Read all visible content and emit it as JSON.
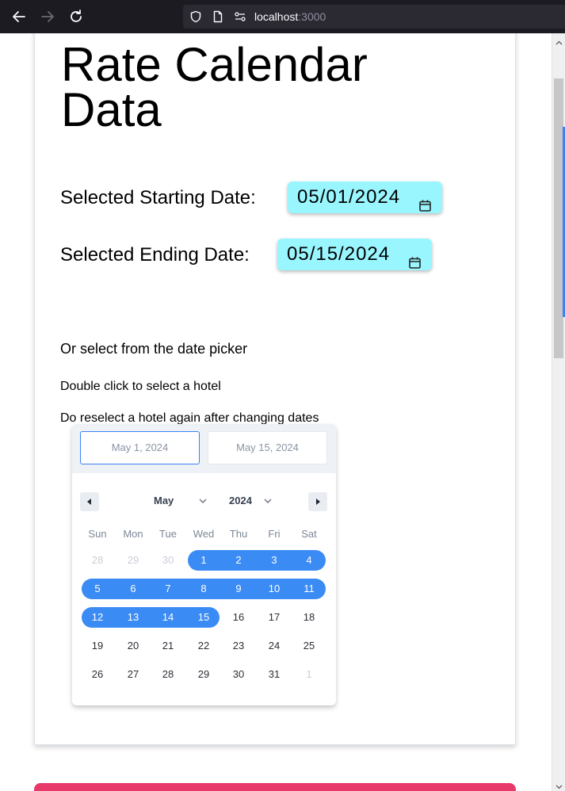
{
  "browser": {
    "url_host": "localhost",
    "url_port": ":3000"
  },
  "page": {
    "title": "Rate Calendar Data",
    "start_label": "Selected Starting Date:",
    "start_value": "05/01/2024",
    "end_label": "Selected Ending Date:",
    "end_value": "05/15/2024",
    "hint_picker": "Or select from the date picker",
    "hint_hotel": "Double click to select a hotel",
    "hint_reselect": "Do reselect a hotel again after changing dates"
  },
  "datepicker": {
    "range_start": "May 1, 2024",
    "range_end": "May 15, 2024",
    "month": "May",
    "year": "2024",
    "weekdays": [
      "Sun",
      "Mon",
      "Tue",
      "Wed",
      "Thu",
      "Fri",
      "Sat"
    ],
    "weeks": [
      [
        "28",
        "29",
        "30",
        "1",
        "2",
        "3",
        "4"
      ],
      [
        "5",
        "6",
        "7",
        "8",
        "9",
        "10",
        "11"
      ],
      [
        "12",
        "13",
        "14",
        "15",
        "16",
        "17",
        "18"
      ],
      [
        "19",
        "20",
        "21",
        "22",
        "23",
        "24",
        "25"
      ],
      [
        "26",
        "27",
        "28",
        "29",
        "30",
        "31",
        "1"
      ]
    ],
    "selected_color": "#3b8bf4"
  },
  "icons": {
    "back": "back-arrow-icon",
    "forward": "forward-arrow-icon",
    "reload": "reload-icon",
    "shield": "shield-icon",
    "page": "page-icon",
    "permissions": "permissions-icon",
    "calendar": "calendar-icon"
  }
}
